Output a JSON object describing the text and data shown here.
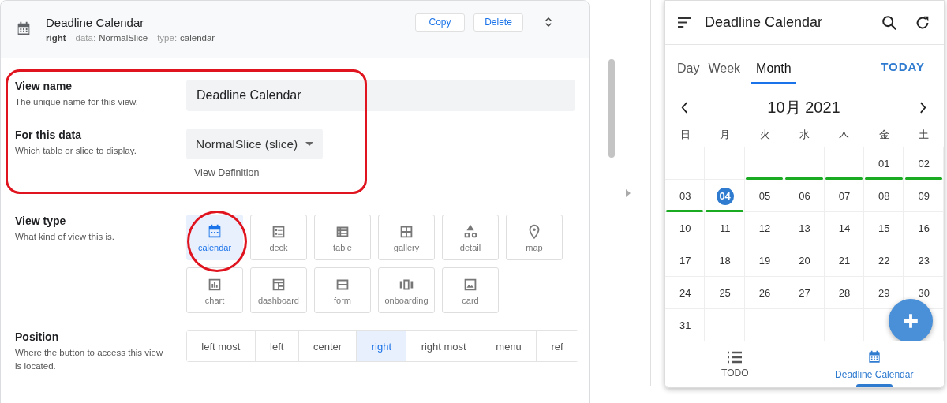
{
  "editor": {
    "title": "Deadline Calendar",
    "position": "right",
    "data_label": "data:",
    "data_value": "NormalSlice",
    "type_label": "type:",
    "type_value": "calendar",
    "buttons": [
      "Copy",
      "Delete"
    ]
  },
  "fields": [
    {
      "kind": "text",
      "label": "View name",
      "description": "The unique name for this view.",
      "value": "Deadline Calendar"
    },
    {
      "kind": "select",
      "label": "For this data",
      "description": "Which table or slice to display.",
      "value": "NormalSlice (slice)",
      "link": "View Definition"
    }
  ],
  "view_type": {
    "label": "View type",
    "description": "What kind of view this is.",
    "options": [
      {
        "label": "calendar",
        "kind": "calendar",
        "selected": true
      },
      {
        "label": "deck",
        "kind": "deck",
        "selected": false
      },
      {
        "label": "table",
        "kind": "table",
        "selected": false
      },
      {
        "label": "gallery",
        "kind": "gallery",
        "selected": false
      },
      {
        "label": "detail",
        "kind": "detail",
        "selected": false
      },
      {
        "label": "map",
        "kind": "map",
        "selected": false
      },
      {
        "label": "chart",
        "kind": "chart",
        "selected": false
      },
      {
        "label": "dashboard",
        "kind": "dashboard",
        "selected": false
      },
      {
        "label": "form",
        "kind": "form",
        "selected": false
      },
      {
        "label": "onboarding",
        "kind": "onboarding",
        "selected": false
      },
      {
        "label": "card",
        "kind": "card",
        "selected": false
      }
    ]
  },
  "position": {
    "label": "Position",
    "description": "Where the button to access this view is located.",
    "options": [
      {
        "label": "left most",
        "selected": false
      },
      {
        "label": "left",
        "selected": false
      },
      {
        "label": "center",
        "selected": false
      },
      {
        "label": "right",
        "selected": true
      },
      {
        "label": "right most",
        "selected": false
      },
      {
        "label": "menu",
        "selected": false
      },
      {
        "label": "ref",
        "selected": false
      }
    ]
  },
  "preview": {
    "title": "Deadline Calendar",
    "tabs": [
      {
        "label": "Day",
        "selected": false
      },
      {
        "label": "Week",
        "selected": false
      },
      {
        "label": "Month",
        "selected": true
      }
    ],
    "today": "TODAY",
    "month": "10月 2021",
    "weekdays": [
      "日",
      "月",
      "火",
      "水",
      "木",
      "金",
      "土"
    ],
    "weeks": [
      [
        {
          "kind": "blank"
        },
        {
          "kind": "blank"
        },
        {
          "kind": "blank",
          "event": true
        },
        {
          "kind": "blank",
          "event": true
        },
        {
          "kind": "blank",
          "event": true
        },
        {
          "day": "01",
          "event": true,
          "selected": false
        },
        {
          "day": "02",
          "event": true,
          "selected": false
        }
      ],
      [
        {
          "day": "03",
          "event": true,
          "selected": false
        },
        {
          "day": "04",
          "event": true,
          "selected": true
        },
        {
          "day": "05",
          "event": false,
          "selected": false
        },
        {
          "day": "06",
          "event": false,
          "selected": false
        },
        {
          "day": "07",
          "event": false,
          "selected": false
        },
        {
          "day": "08",
          "event": false,
          "selected": false
        },
        {
          "day": "09",
          "event": false,
          "selected": false
        }
      ],
      [
        {
          "day": "10",
          "event": false,
          "selected": false
        },
        {
          "day": "11",
          "event": false,
          "selected": false
        },
        {
          "day": "12",
          "event": false,
          "selected": false
        },
        {
          "day": "13",
          "event": false,
          "selected": false
        },
        {
          "day": "14",
          "event": false,
          "selected": false
        },
        {
          "day": "15",
          "event": false,
          "selected": false
        },
        {
          "day": "16",
          "event": false,
          "selected": false
        }
      ],
      [
        {
          "day": "17",
          "event": false,
          "selected": false
        },
        {
          "day": "18",
          "event": false,
          "selected": false
        },
        {
          "day": "19",
          "event": false,
          "selected": false
        },
        {
          "day": "20",
          "event": false,
          "selected": false
        },
        {
          "day": "21",
          "event": false,
          "selected": false
        },
        {
          "day": "22",
          "event": false,
          "selected": false
        },
        {
          "day": "23",
          "event": false,
          "selected": false
        }
      ],
      [
        {
          "day": "24",
          "event": false,
          "selected": false
        },
        {
          "day": "25",
          "event": false,
          "selected": false
        },
        {
          "day": "26",
          "event": false,
          "selected": false
        },
        {
          "day": "27",
          "event": false,
          "selected": false
        },
        {
          "day": "28",
          "event": false,
          "selected": false
        },
        {
          "day": "29",
          "event": false,
          "selected": false
        },
        {
          "day": "30",
          "event": false,
          "selected": false
        }
      ],
      [
        {
          "day": "31",
          "event": false,
          "selected": false
        },
        {
          "kind": "blank"
        },
        {
          "kind": "blank"
        },
        {
          "kind": "blank"
        },
        {
          "kind": "blank"
        },
        {
          "kind": "blank"
        },
        {
          "kind": "blank"
        }
      ]
    ],
    "nav": [
      {
        "label": "TODO",
        "kind": "list",
        "selected": false
      },
      {
        "label": "Deadline Calendar",
        "kind": "calendar",
        "selected": true
      }
    ]
  }
}
